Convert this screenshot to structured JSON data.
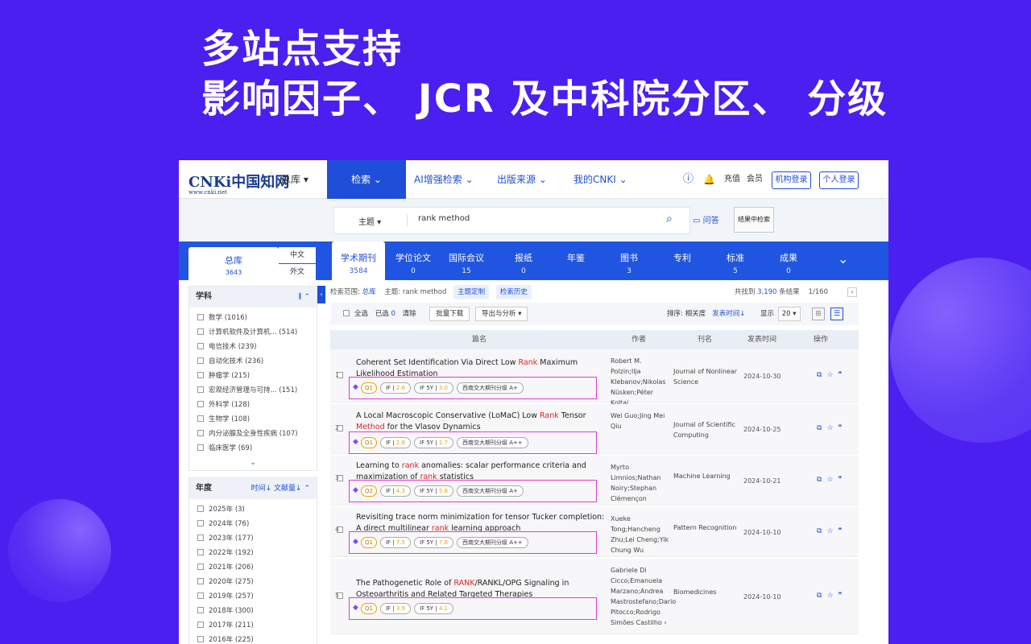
{
  "headline": {
    "line1": "多站点支持",
    "line2": "影响因子、 JCR 及中科院分区、 分级"
  },
  "nav": {
    "logo": "CNKi中国知网",
    "logo_url": "www.cnki.net",
    "db": "总库 ▾",
    "menu": [
      "检索 ⌄",
      "AI增强检索 ⌄",
      "出版来源 ⌄",
      "我的CNKI ⌄"
    ],
    "recharge": "充值",
    "member": "会员",
    "inst_login": "机构登录",
    "personal_login": "个人登录"
  },
  "search": {
    "field": "主题 ▾",
    "value": "rank method",
    "qa": "问答",
    "in_result": "结果中检索"
  },
  "tabs": {
    "all": "总库",
    "all_count": "3643",
    "zh": "中文",
    "wai": "外文",
    "items": [
      {
        "label": "学术期刊",
        "count": "3584"
      },
      {
        "label": "学位论文",
        "count": "0"
      },
      {
        "label": "国际会议",
        "count": "15"
      },
      {
        "label": "报纸",
        "count": "0"
      },
      {
        "label": "年鉴",
        "count": ""
      },
      {
        "label": "图书",
        "count": "3"
      },
      {
        "label": "专利",
        "count": ""
      },
      {
        "label": "标准",
        "count": "5"
      },
      {
        "label": "成果",
        "count": "0"
      }
    ]
  },
  "sidebar": {
    "subject_title": "学科",
    "subjects": [
      "数学 (1016)",
      "计算机软件及计算机...  (514)",
      "电信技术 (239)",
      "自动化技术 (236)",
      "肿瘤学 (215)",
      "宏观经济管理与可持...  (151)",
      "外科学 (128)",
      "生物学 (108)",
      "内分泌腺及全身性疾病 (107)",
      "临床医学 (69)"
    ],
    "year_title": "年度",
    "year_sort_time": "时间↓",
    "year_sort_cite": "文献量↓",
    "years": [
      "2025年 (3)",
      "2024年 (76)",
      "2023年 (177)",
      "2022年 (192)",
      "2021年 (206)",
      "2020年 (275)",
      "2019年 (257)",
      "2018年 (300)",
      "2017年 (211)",
      "2016年 (225)"
    ]
  },
  "results": {
    "scope_label": "检索范围:",
    "scope": "总库",
    "topic": "主题: rank method",
    "custom": "主题定制",
    "history": "检索历史",
    "found_prefix": "共找到",
    "found": "3,190",
    "found_suffix": "条结果",
    "page": "1/160",
    "select_all": "全选",
    "selected": "已选",
    "selected_n": "0",
    "clear": "清除",
    "batch": "批量下载",
    "export": "导出与分析 ▾",
    "sort": "排序:",
    "relevance": "相关度",
    "pubtime": "发表时间↓",
    "display": "显示",
    "per_page": "20 ▾",
    "cols": {
      "title": "篇名",
      "author": "作者",
      "journal": "刊名",
      "date": "发表时间",
      "ops": "操作"
    },
    "rows": [
      {
        "num": "1",
        "t1": "Coherent Set Identification Via Direct Low ",
        "hl": "Rank",
        "t2": " Maximum Likelihood Estimation",
        "author": "Robert M. Polzin;Ilja Klebanov;Nikolas Nüsken;Péter Koltai",
        "journal": "Journal of Nonlinear Science",
        "date": "2024-10-30",
        "q": "Q1",
        "if": "2.6",
        "if5": "3.0",
        "grade": "西南交大期刊分级  A+"
      },
      {
        "num": "2",
        "t1": "A Local Macroscopic Conservative (LoMaC) Low ",
        "hl": "Rank",
        "t2": " Tensor ",
        "hl2": "Method",
        "t3": " for the Vlasov Dynamics",
        "author": "Wei Guo;Jing Mei Qiu",
        "journal": "Journal of Scientific Computing",
        "date": "2024-10-25",
        "q": "Q1",
        "if": "2.8",
        "if5": "2.7",
        "grade": "西南交大期刊分级  A++"
      },
      {
        "num": "3",
        "t1": "Learning to ",
        "hl": "rank",
        "t2": " anomalies: scalar performance criteria and maximization of ",
        "hl2": "rank",
        "t3": " statistics",
        "author": "Myrto Limnios;Nathan Noiry;Stephan Clémençon",
        "journal": "Machine Learning",
        "date": "2024-10-21",
        "q": "Q2",
        "if": "4.3",
        "if5": "5.8",
        "grade": "西南交大期刊分级  A+"
      },
      {
        "num": "4",
        "t1": "Revisiting trace norm minimization for tensor Tucker completion: A direct multilinear ",
        "hl": "rank",
        "t2": " learning approach",
        "author": "Xueke Tong;Hancheng Zhu;Lei Cheng;Yik Chung Wu",
        "journal": "Pattern Recognition",
        "date": "2024-10-10",
        "q": "Q1",
        "if": "7.5",
        "if5": "7.6",
        "grade": "西南交大期刊分级  A++"
      },
      {
        "num": "5",
        "t1": "The Pathogenetic Role of ",
        "hl": "RANK",
        "t2": "/RANKL/OPG Signaling in Osteoarthritis and Related Targeted Therapies",
        "author": "Gabriele Di Cicco;Emanuela Marzano;Andrea Mastrostefano;Dario Pitocco;Rodrigo Simões Castilho ›",
        "journal": "Biomedicines",
        "date": "2024-10-10",
        "q": "Q1",
        "if": "3.9",
        "if5": "4.1",
        "grade": ""
      }
    ]
  },
  "colors": {
    "bg": "#4a1ff0",
    "accent": "#1f4ed8",
    "highlight": "#e02020",
    "badge_border": "#e23ad0"
  }
}
